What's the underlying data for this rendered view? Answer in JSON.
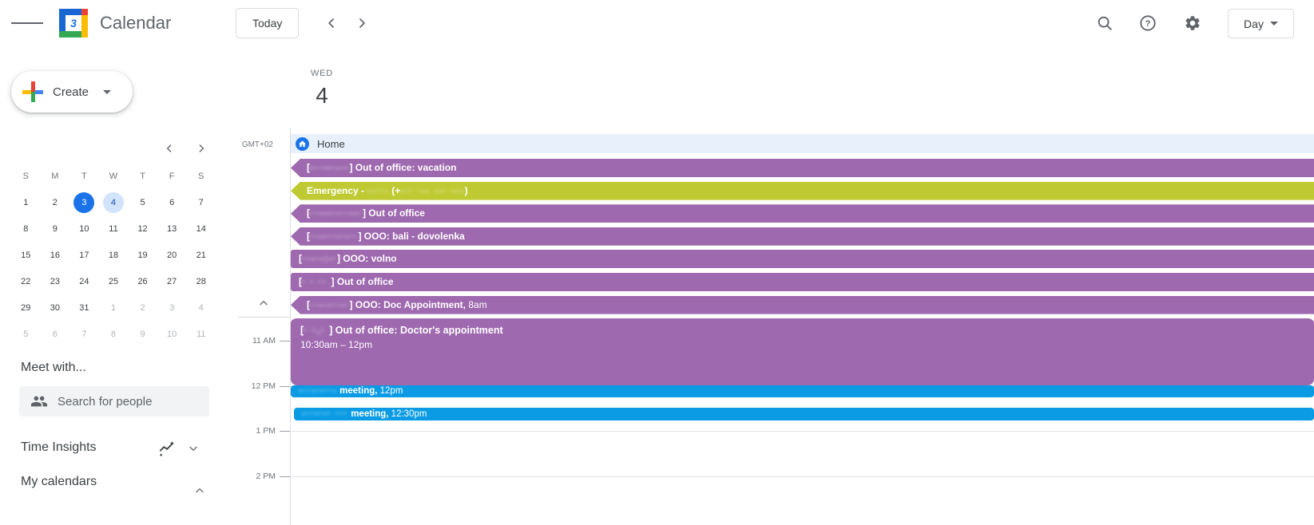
{
  "header": {
    "app_name": "Calendar",
    "logo_day": "3",
    "today_button": "Today",
    "view_selector": "Day"
  },
  "sidebar": {
    "create_label": "Create",
    "mini_calendar": {
      "weekday_headers": [
        "S",
        "M",
        "T",
        "W",
        "T",
        "F",
        "S"
      ],
      "weeks": [
        [
          {
            "d": "1"
          },
          {
            "d": "2"
          },
          {
            "d": "3",
            "state": "today"
          },
          {
            "d": "4",
            "state": "viewed"
          },
          {
            "d": "5"
          },
          {
            "d": "6"
          },
          {
            "d": "7"
          }
        ],
        [
          {
            "d": "8"
          },
          {
            "d": "9"
          },
          {
            "d": "10"
          },
          {
            "d": "11"
          },
          {
            "d": "12"
          },
          {
            "d": "13"
          },
          {
            "d": "14"
          }
        ],
        [
          {
            "d": "15"
          },
          {
            "d": "16"
          },
          {
            "d": "17"
          },
          {
            "d": "18"
          },
          {
            "d": "19"
          },
          {
            "d": "20"
          },
          {
            "d": "21"
          }
        ],
        [
          {
            "d": "22"
          },
          {
            "d": "23"
          },
          {
            "d": "24"
          },
          {
            "d": "25"
          },
          {
            "d": "26"
          },
          {
            "d": "27"
          },
          {
            "d": "28"
          }
        ],
        [
          {
            "d": "29"
          },
          {
            "d": "30"
          },
          {
            "d": "31"
          },
          {
            "d": "1",
            "state": "muted"
          },
          {
            "d": "2",
            "state": "muted"
          },
          {
            "d": "3",
            "state": "muted"
          },
          {
            "d": "4",
            "state": "muted"
          }
        ],
        [
          {
            "d": "5",
            "state": "muted"
          },
          {
            "d": "6",
            "state": "muted"
          },
          {
            "d": "7",
            "state": "muted"
          },
          {
            "d": "8",
            "state": "muted"
          },
          {
            "d": "9",
            "state": "muted"
          },
          {
            "d": "10",
            "state": "muted"
          },
          {
            "d": "11",
            "state": "muted"
          }
        ]
      ]
    },
    "meet_with_title": "Meet with...",
    "search_people_placeholder": "Search for people",
    "time_insights_label": "Time Insights",
    "my_calendars_label": "My calendars"
  },
  "main": {
    "day_of_week": "WED",
    "day_number": "4",
    "timezone": "GMT+02",
    "working_location": {
      "label": "Home"
    },
    "hours": [
      "11 AM",
      "12 PM",
      "1 PM",
      "2 PM"
    ],
    "colors": {
      "purple": "#9e69af",
      "green": "#bfca33",
      "blue": "#0a9be4",
      "home_chip_bg": "#e7f0fb",
      "accent": "#1a73e8",
      "viewed_day_bg": "#d2e3fc"
    },
    "allday_events": [
      {
        "shape": "arrow",
        "color_key": "purple",
        "segments": [
          {
            "t": "["
          },
          {
            "t": "-··--·-·-",
            "mask": true
          },
          {
            "t": "] Out of office: vacation"
          }
        ]
      },
      {
        "shape": "arrow",
        "color_key": "green",
        "segments": [
          {
            "t": "Emergency - "
          },
          {
            "t": "--··-",
            "mask": true
          },
          {
            "t": " (+"
          },
          {
            "t": "-·· ·-- --· ---",
            "mask": true
          },
          {
            "t": ")"
          }
        ]
      },
      {
        "shape": "arrow",
        "color_key": "purple",
        "segments": [
          {
            "t": "["
          },
          {
            "t": "··---·-··--·",
            "mask": true
          },
          {
            "t": "] Out of office"
          }
        ]
      },
      {
        "shape": "arrow",
        "color_key": "purple",
        "segments": [
          {
            "t": "["
          },
          {
            "t": "··--··-·-··",
            "mask": true
          },
          {
            "t": "] OOO: bali - dovolenka"
          }
        ]
      },
      {
        "shape": "square",
        "color_key": "purple",
        "segments": [
          {
            "t": "["
          },
          {
            "t": "··-·-:-·",
            "mask": true
          },
          {
            "t": "] OOO: volno"
          }
        ]
      },
      {
        "shape": "square",
        "color_key": "purple",
        "segments": [
          {
            "t": "["
          },
          {
            "t": "·  ·   ·· ",
            "mask": true
          },
          {
            "t": "] Out of office"
          }
        ]
      },
      {
        "shape": "arrow",
        "color_key": "purple",
        "segments": [
          {
            "t": "["
          },
          {
            "t": "··-·-··-·",
            "mask": true
          },
          {
            "t": "] OOO: Doc Appointment,"
          },
          {
            "t": " 8am",
            "light": true
          }
        ]
      }
    ],
    "timed_events": [
      {
        "kind": "block",
        "color_key": "purple",
        "segments": [
          {
            "t": "["
          },
          {
            "t": "· ·.· ",
            "mask": true
          },
          {
            "t": "] Out of office: Doctor's appointment"
          }
        ],
        "time_text": "10:30am – 12pm"
      },
      {
        "kind": "bar",
        "color_key": "blue",
        "segments": [
          {
            "t": "-··-·-··-",
            "mask": true
          },
          {
            "t": " meeting,"
          },
          {
            "t": " 12pm",
            "light": true
          }
        ]
      },
      {
        "kind": "bar",
        "color_key": "blue",
        "segments": [
          {
            "t": "-··-·-· ···",
            "mask": true
          },
          {
            "t": " meeting,"
          },
          {
            "t": " 12:30pm",
            "light": true
          }
        ]
      }
    ]
  }
}
